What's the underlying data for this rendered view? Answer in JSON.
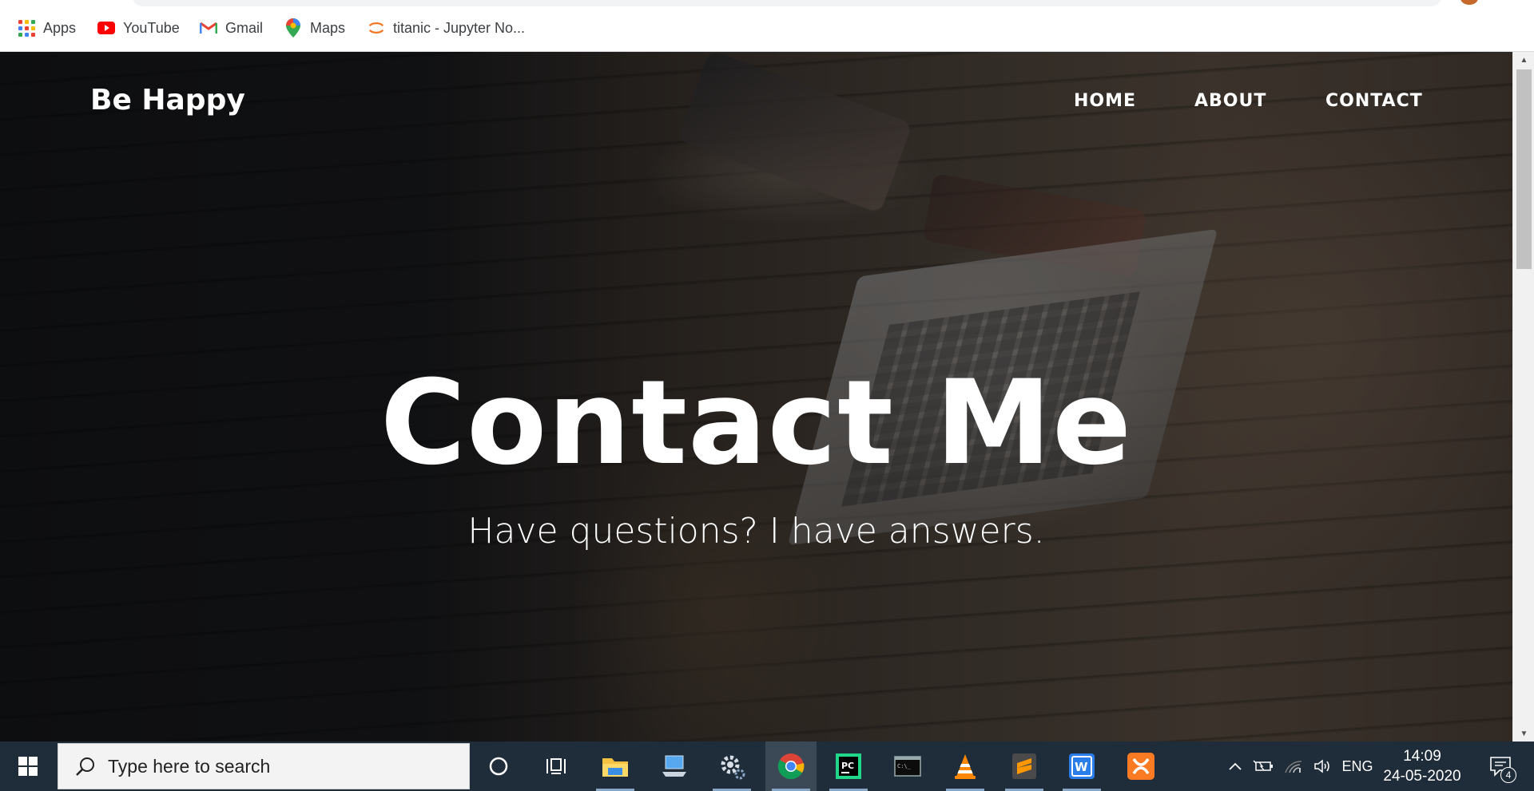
{
  "bookmarks": [
    {
      "label": "Apps",
      "icon": "apps-grid-icon"
    },
    {
      "label": "YouTube",
      "icon": "youtube-icon"
    },
    {
      "label": "Gmail",
      "icon": "gmail-icon"
    },
    {
      "label": "Maps",
      "icon": "maps-icon"
    },
    {
      "label": "titanic - Jupyter No...",
      "icon": "jupyter-icon"
    }
  ],
  "site": {
    "brand": "Be Happy",
    "nav": [
      "HOME",
      "ABOUT",
      "CONTACT"
    ],
    "hero_title": "Contact Me",
    "hero_subtitle": "Have questions? I have answers."
  },
  "taskbar": {
    "search_placeholder": "Type here to search",
    "apps": [
      "cortana-icon",
      "task-view-icon",
      "file-explorer-icon",
      "this-pc-icon",
      "settings-gear-icon",
      "chrome-icon",
      "pycharm-icon",
      "terminal-icon",
      "vlc-icon",
      "sublime-text-icon",
      "wps-office-icon",
      "xampp-icon"
    ],
    "tray": {
      "language": "ENG",
      "time": "14:09",
      "date": "24-05-2020",
      "notifications": "4"
    }
  },
  "colors": {
    "taskbar": "#1f2d3a",
    "youtube_red": "#ff0000",
    "chrome_active": "#3b4957"
  }
}
